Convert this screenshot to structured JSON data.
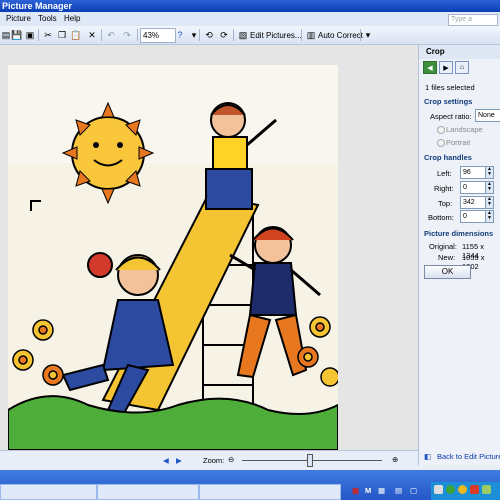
{
  "window": {
    "title": "Picture Manager"
  },
  "menu": {
    "items": [
      "Picture",
      "Tools",
      "Help"
    ],
    "help_placeholder": "Type a question"
  },
  "toolbar": {
    "zoom_value": "43%",
    "edit_pictures_label": "Edit Pictures...",
    "auto_correct_label": "Auto Correct"
  },
  "crop_panel": {
    "title": "Crop",
    "files_selected": "1 files selected",
    "crop_settings_header": "Crop settings",
    "aspect_ratio_label": "Aspect ratio:",
    "aspect_ratio_value": "None",
    "landscape_label": "Landscape",
    "portrait_label": "Portrait",
    "crop_handles_header": "Crop handles",
    "left_label": "Left:",
    "left_value": "96",
    "right_label": "Right:",
    "right_value": "0",
    "top_label": "Top:",
    "top_value": "342",
    "bottom_label": "Bottom:",
    "bottom_value": "0",
    "dimensions_header": "Picture dimensions",
    "original_label": "Original:",
    "original_value": "1155 x 1344",
    "new_label": "New:",
    "new_value": "1059 x 1002",
    "ok_label": "OK",
    "back_link": "Back to Edit Pictures"
  },
  "status": {
    "zoom_label": "Zoom:",
    "zoom_percent": 0.48
  },
  "taskbar": {
    "app_letter": "M"
  }
}
